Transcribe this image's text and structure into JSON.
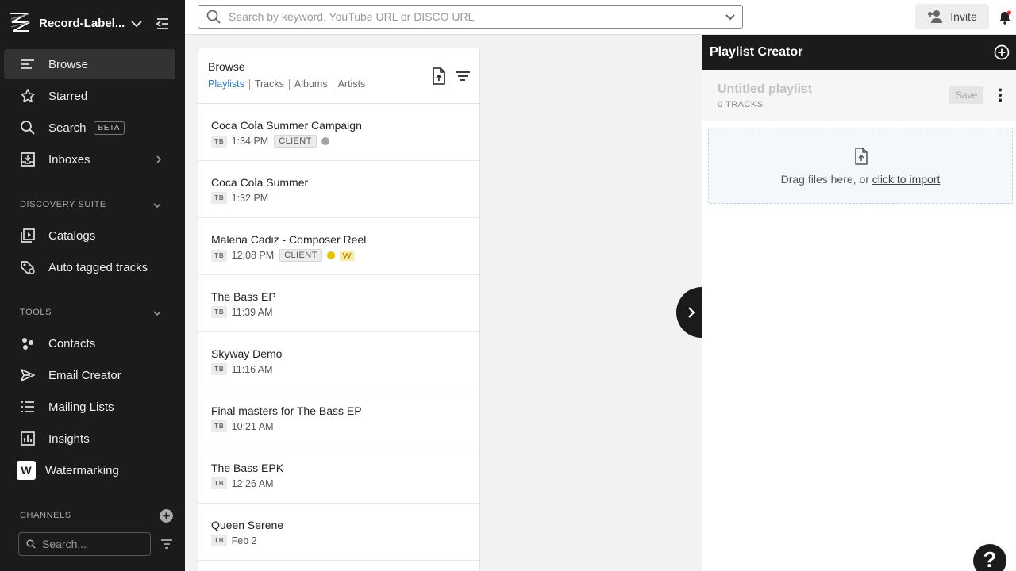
{
  "sidebar": {
    "brand": "Record-Label...",
    "nav": [
      {
        "label": "Browse",
        "badge": ""
      },
      {
        "label": "Starred",
        "badge": ""
      },
      {
        "label": "Search",
        "badge": "BETA"
      },
      {
        "label": "Inboxes",
        "badge": ""
      }
    ],
    "discovery": {
      "heading": "DISCOVERY SUITE",
      "items": [
        {
          "label": "Catalogs"
        },
        {
          "label": "Auto tagged tracks"
        }
      ]
    },
    "tools": {
      "heading": "TOOLS",
      "items": [
        {
          "label": "Contacts"
        },
        {
          "label": "Email Creator"
        },
        {
          "label": "Mailing Lists"
        },
        {
          "label": "Insights"
        },
        {
          "label": "Watermarking",
          "badge_letter": "W"
        }
      ]
    },
    "channels": {
      "heading": "CHANNELS",
      "search_placeholder": "Search..."
    }
  },
  "topbar": {
    "search_placeholder": "Search by keyword, YouTube URL or DISCO URL",
    "invite_label": "Invite"
  },
  "browse": {
    "title": "Browse",
    "tabs": [
      "Playlists",
      "Tracks",
      "Albums",
      "Artists"
    ],
    "active_tab": "Playlists",
    "items": [
      {
        "title": "Coca Cola Summer Campaign",
        "owner": "TB",
        "time": "1:34 PM",
        "tag": "CLIENT",
        "dot_color": "#a4a4a4",
        "watermark": false
      },
      {
        "title": "Coca Cola Summer",
        "owner": "TB",
        "time": "1:32 PM",
        "tag": "",
        "dot_color": "",
        "watermark": false
      },
      {
        "title": "Malena Cadiz - Composer Reel",
        "owner": "TB",
        "time": "12:08 PM",
        "tag": "CLIENT",
        "dot_color": "#e8c200",
        "watermark": true
      },
      {
        "title": "The Bass EP",
        "owner": "TB",
        "time": "11:39 AM",
        "tag": "",
        "dot_color": "",
        "watermark": false
      },
      {
        "title": "Skyway Demo",
        "owner": "TB",
        "time": "11:16 AM",
        "tag": "",
        "dot_color": "",
        "watermark": false
      },
      {
        "title": "Final masters for The Bass EP",
        "owner": "TB",
        "time": "10:21 AM",
        "tag": "",
        "dot_color": "",
        "watermark": false
      },
      {
        "title": "The Bass EPK",
        "owner": "TB",
        "time": "12:26 AM",
        "tag": "",
        "dot_color": "",
        "watermark": false
      },
      {
        "title": "Queen Serene",
        "owner": "TB",
        "time": "Feb 2",
        "tag": "",
        "dot_color": "",
        "watermark": false
      }
    ]
  },
  "playlist_creator": {
    "title": "Playlist Creator",
    "playlist_name": "Untitled playlist",
    "track_count": "0 TRACKS",
    "save_label": "Save",
    "drop_text": "Drag files here, or ",
    "drop_link": "click to import"
  },
  "help_label": "?"
}
